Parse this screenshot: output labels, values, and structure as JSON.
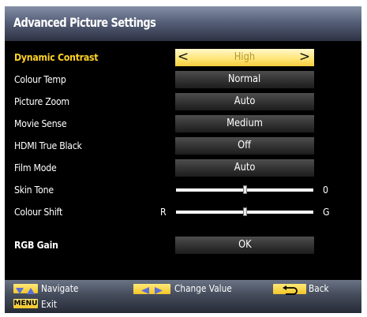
{
  "title": "Advanced Picture Settings",
  "rows": [
    {
      "label": "Dynamic Contrast",
      "value": "High"
    },
    {
      "label": "Colour Temp",
      "value": "Normal"
    },
    {
      "label": "Picture Zoom",
      "value": "Auto"
    },
    {
      "label": "Movie Sense",
      "value": "Medium"
    },
    {
      "label": "HDMI True Black",
      "value": "Off"
    },
    {
      "label": "Film Mode",
      "value": "Auto"
    },
    {
      "label": "Skin Tone",
      "slider_level": 0.5,
      "right_text": "0"
    },
    {
      "label": "Colour Shift",
      "slider_level": 0.5,
      "left_text": "R",
      "right_text": "G"
    },
    {
      "label": "RGB Gain",
      "value": "OK"
    }
  ],
  "arrows": {
    "left": "<",
    "right": ">"
  },
  "footer": {
    "navigate": "Navigate",
    "change_value": "Change Value",
    "back": "Back",
    "menu_key": "MENU",
    "exit": "Exit"
  },
  "colors": {
    "selected_label": "#ffd227",
    "selected_box": "#ffe67a",
    "key_yellow": "#f3c628"
  },
  "icons": {
    "navigate": [
      "down-arrow-icon",
      "up-arrow-icon"
    ],
    "change_value": [
      "left-arrow-icon",
      "right-arrow-icon"
    ],
    "back": "back-return-icon"
  }
}
